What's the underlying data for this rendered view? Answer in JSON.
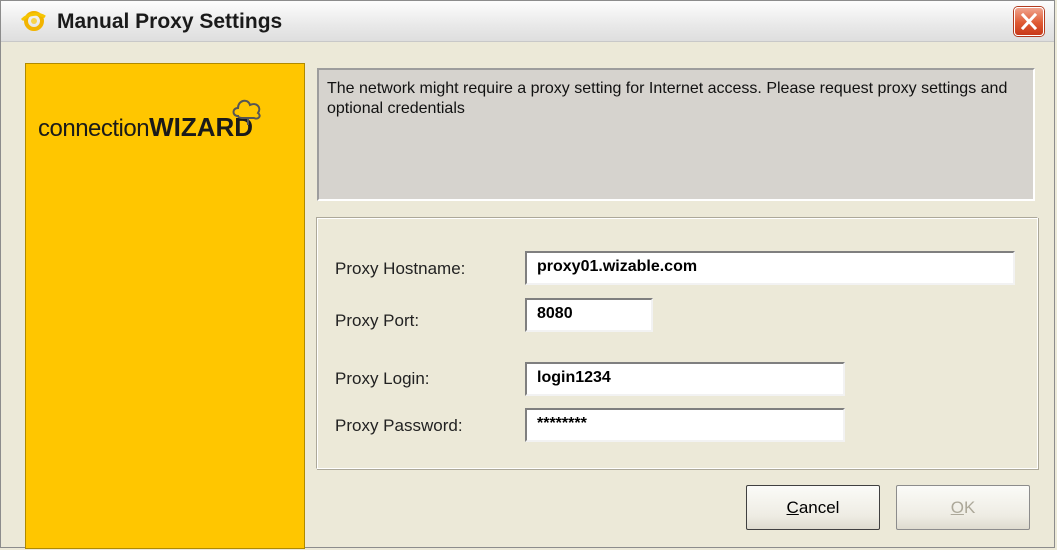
{
  "window": {
    "title": "Manual Proxy Settings"
  },
  "brand": {
    "logo_prefix": "connection",
    "logo_suffix": "WIZARD",
    "panel_color": "#ffc600"
  },
  "info": {
    "message": "The network might require a proxy setting for Internet access. Please request proxy settings and optional credentials"
  },
  "form": {
    "hostname_label": "Proxy Hostname:",
    "hostname_value": "proxy01.wizable.com",
    "port_label": "Proxy Port:",
    "port_value": "8080",
    "login_label": "Proxy Login:",
    "login_value": "login1234",
    "password_label": "Proxy Password:",
    "password_value": "********"
  },
  "buttons": {
    "cancel_mnemonic": "C",
    "cancel_rest": "ancel",
    "ok_mnemonic": "O",
    "ok_rest": "K"
  },
  "icons": {
    "title_icon": "app-logo-icon",
    "close": "close-icon",
    "logo": "cloud-icon"
  }
}
